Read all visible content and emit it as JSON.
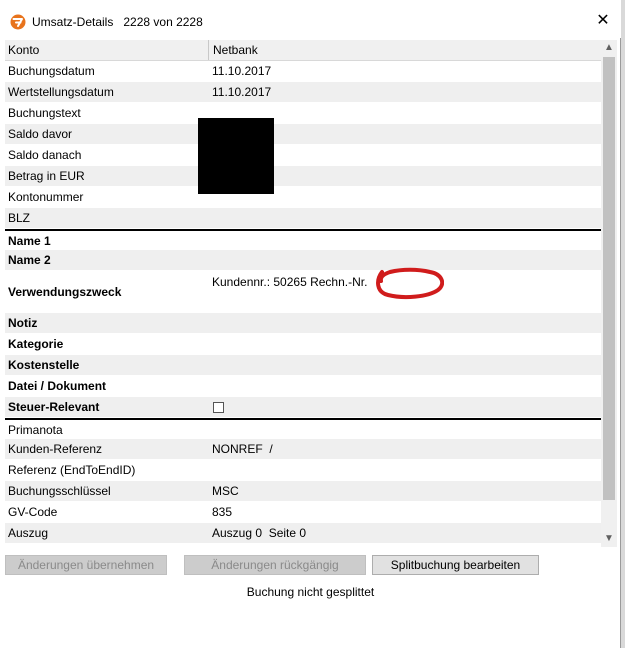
{
  "window": {
    "title": "Umsatz-Details",
    "counter": "2228 von 2228",
    "close_glyph": "✕"
  },
  "grid": {
    "header": {
      "label": "Konto",
      "value": "Netbank"
    },
    "rows": [
      {
        "label": "Buchungsdatum",
        "value": "11.10.2017"
      },
      {
        "label": "Wertstellungsdatum",
        "value": "11.10.2017"
      },
      {
        "label": "Buchungstext",
        "value": ""
      },
      {
        "label": "Saldo davor",
        "value": ""
      },
      {
        "label": "Saldo danach",
        "value": ""
      },
      {
        "label": "Betrag in EUR",
        "value": ""
      },
      {
        "label": "Kontonummer",
        "value": ""
      },
      {
        "label": "BLZ",
        "value": ""
      },
      {
        "label": "Name 1",
        "value": ""
      },
      {
        "label": "Name 2",
        "value": ""
      },
      {
        "label": "Verwendungszweck",
        "value": "Kundennr.: 50265 Rechn.-Nr."
      },
      {
        "label": "Notiz",
        "value": ""
      },
      {
        "label": "Kategorie",
        "value": ""
      },
      {
        "label": "Kostenstelle",
        "value": ""
      },
      {
        "label": "Datei / Dokument",
        "value": ""
      },
      {
        "label": "Steuer-Relevant",
        "value": ""
      },
      {
        "label": "Primanota",
        "value": ""
      },
      {
        "label": "Kunden-Referenz",
        "value": "NONREF  /"
      },
      {
        "label": "Referenz (EndToEndID)",
        "value": ""
      },
      {
        "label": "Buchungsschlüssel",
        "value": "MSC"
      },
      {
        "label": "GV-Code",
        "value": "835"
      },
      {
        "label": "Auszug",
        "value": "Auszug 0  Seite 0"
      }
    ]
  },
  "buttons": {
    "apply": "Änderungen übernehmen",
    "undo": "Änderungen rückgängig",
    "split": "Splitbuchung bearbeiten"
  },
  "status": "Buchung nicht gesplittet",
  "colors": {
    "accent": "#e8731c",
    "scribble": "#d01c1c"
  }
}
